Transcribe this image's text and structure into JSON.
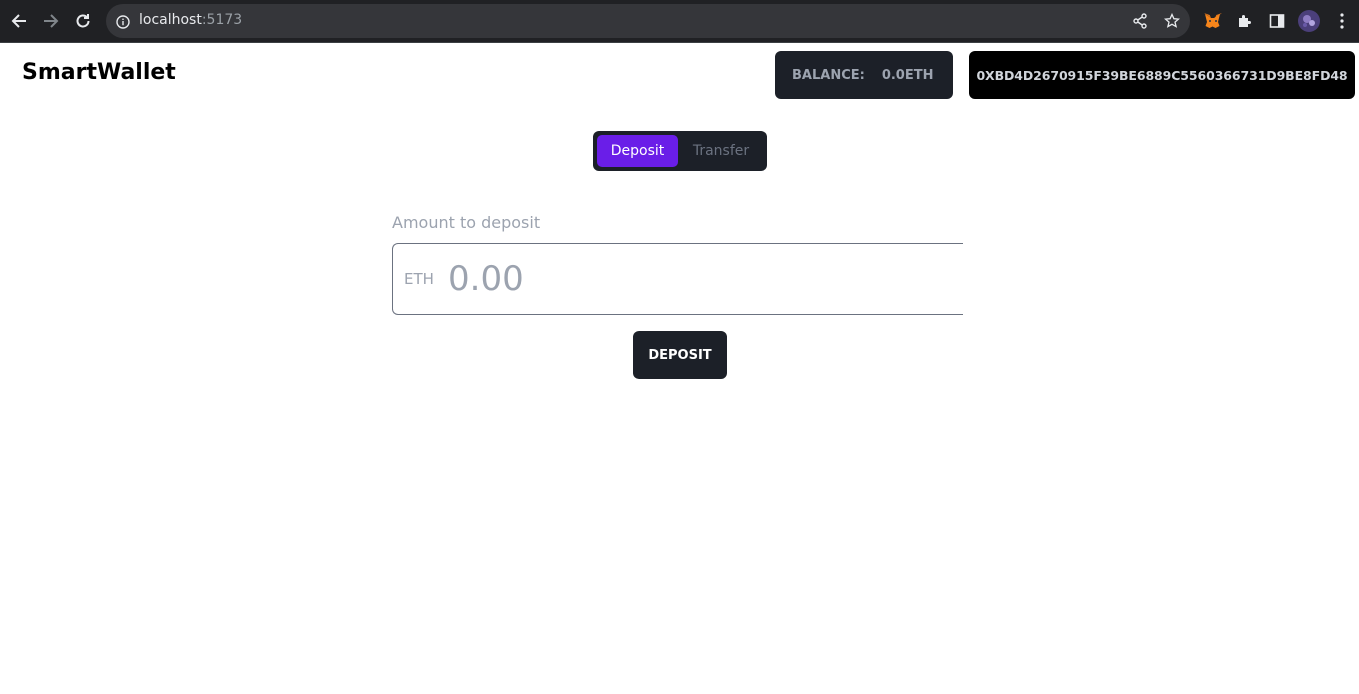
{
  "browser": {
    "url_host": "localhost",
    "url_port": ":5173",
    "icons": [
      "back-icon",
      "forward-icon",
      "reload-icon",
      "info-icon",
      "share-icon",
      "star-icon",
      "metamask-fox-icon",
      "puzzle-extensions-icon",
      "side-panel-icon",
      "profile-avatar",
      "kebab-menu-icon"
    ]
  },
  "header": {
    "brand": "SmartWallet",
    "balance_label": "BALANCE:",
    "balance_value": "0.0ETH",
    "address": "0XBD4D2670915F39BE6889C5560366731D9BE8FD48"
  },
  "tabs": {
    "deposit": "Deposit",
    "transfer": "Transfer",
    "active": "Deposit"
  },
  "form": {
    "label": "Amount to deposit",
    "prefix": "ETH",
    "placeholder": "0.00",
    "value": "",
    "submit": "DEPOSIT"
  },
  "colors": {
    "accent": "#6a1ee8",
    "dark_panel": "#1c2028",
    "chrome_bg": "#202124"
  }
}
